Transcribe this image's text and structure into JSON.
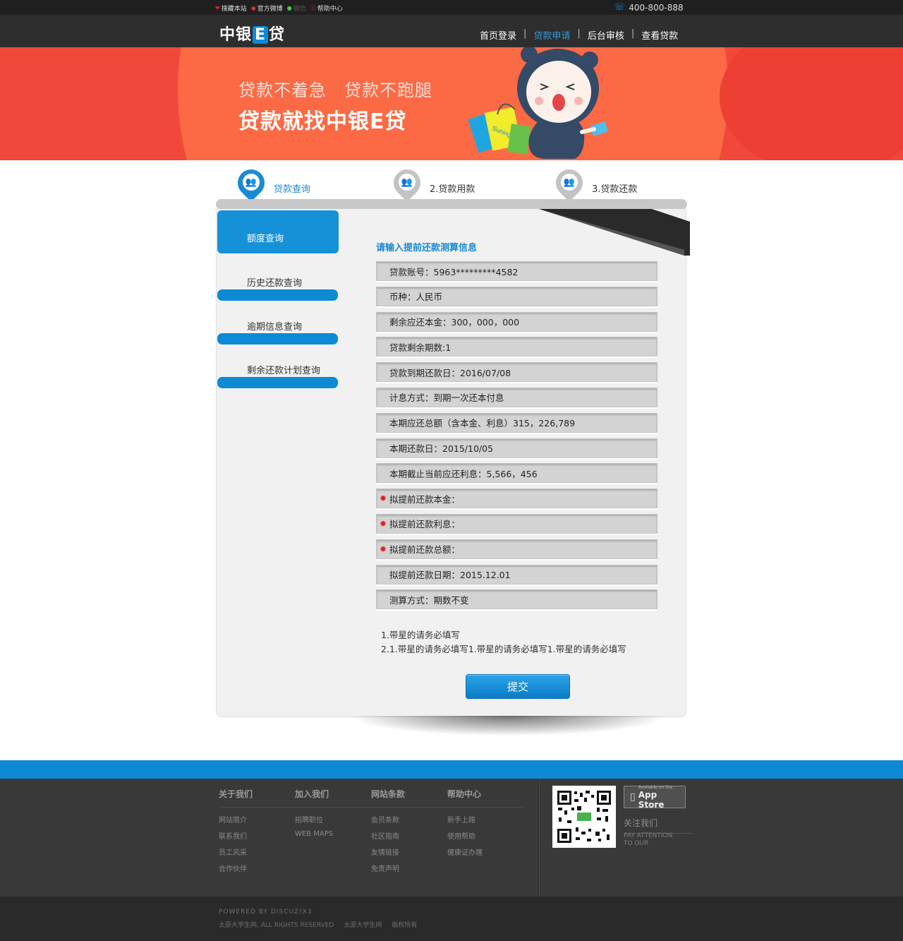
{
  "topbar": {
    "links": [
      "搜藏本站",
      "官方微博",
      "微信",
      "帮助中心"
    ],
    "phone": "400-800-888"
  },
  "header": {
    "logo_pre": "中银",
    "logo_e": "E",
    "logo_post": "贷",
    "nav": [
      "首页登录",
      "贷款申请",
      "后台审核",
      "查看贷款"
    ],
    "active_nav": "贷款申请"
  },
  "banner": {
    "slogan_line1": "贷款不着急　贷款不跑腿",
    "slogan_line2": "贷款就找中银E贷",
    "bag_text": "Suning",
    "colors": {
      "base": "#f0483b",
      "circle": "#fb6a45"
    }
  },
  "steps": [
    {
      "label": "贷款查询",
      "active": true
    },
    {
      "label": "2.贷款用款",
      "active": false
    },
    {
      "label": "3.贷款还款",
      "active": false
    }
  ],
  "sidebar": {
    "items": [
      "额度查询",
      "历史还款查询",
      "逾期信息查询",
      "剩余还款计划查询"
    ],
    "active": "额度查询"
  },
  "form": {
    "title": "请输入提前还款测算信息",
    "rows": [
      {
        "text": "贷款账号：5963*********4582",
        "required": false
      },
      {
        "text": "币种：人民币",
        "required": false
      },
      {
        "text": "剩余应还本金：300，000，000",
        "required": false
      },
      {
        "text": "贷款剩余期数:1",
        "required": false
      },
      {
        "text": "贷款到期还款日：2016/07/08",
        "required": false
      },
      {
        "text": "计息方式：到期一次还本付息",
        "required": false
      },
      {
        "text": "本期应还总额（含本金、利息）315，226,789",
        "required": false
      },
      {
        "text": "本期还款日：2015/10/05",
        "required": false
      },
      {
        "text": "本期截止当前应还利息：5,566，456",
        "required": false
      },
      {
        "text": "拟提前还款本金：",
        "required": true
      },
      {
        "text": "拟提前还款利息：",
        "required": true
      },
      {
        "text": "拟提前还款总额：",
        "required": true
      },
      {
        "text": "拟提前还款日期：2015.12.01",
        "required": false
      },
      {
        "text": "测算方式：期数不变",
        "required": false
      }
    ],
    "note1": "1.带星的请务必填写",
    "note2": "2.1.带星的请务必填写1.带星的请务必填写1.带星的请务必填写",
    "submit": "提交"
  },
  "footer": {
    "columns": [
      {
        "heading": "关于我们",
        "items": [
          "网站简介",
          "联系我们",
          "员工风采",
          "合作伙伴"
        ]
      },
      {
        "heading": "加入我们",
        "items": [
          "招聘职位",
          "WEB MAPS"
        ]
      },
      {
        "heading": "网站条款",
        "items": [
          "会员条款",
          "社区指南",
          "友情链接",
          "免责声明"
        ]
      },
      {
        "heading": "帮助中心",
        "items": [
          "新手上路",
          "使用帮助",
          "健康证办理"
        ]
      }
    ],
    "appstore_small": "Available on the",
    "appstore_big": "App Store",
    "follow": "关注我们",
    "follow_en1": "PAY ATTENTION",
    "follow_en2": "TO OUR",
    "powered": "POWERED BY DISCUZ!X3",
    "copyright": [
      "太原大学生网, ALL RIGHTS RESERVED",
      "太原大学生网",
      "版权所有"
    ]
  }
}
